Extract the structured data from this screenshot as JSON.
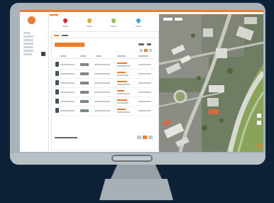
{
  "colors": {
    "accent": "#ef7d2e",
    "background": "#0d2236",
    "monitor_frame": "#a9b3b9"
  },
  "screen": {
    "pins": [
      {
        "icon": "map-pin-icon",
        "color": "#e0242b"
      },
      {
        "icon": "map-pin-icon",
        "color": "#f2a41a"
      },
      {
        "icon": "map-pin-icon",
        "color": "#8cc63f"
      },
      {
        "icon": "map-pin-icon",
        "color": "#2aa9e0"
      }
    ],
    "table_rows": 6,
    "map": {
      "type": "satellite",
      "icon": "satellite-map"
    }
  }
}
